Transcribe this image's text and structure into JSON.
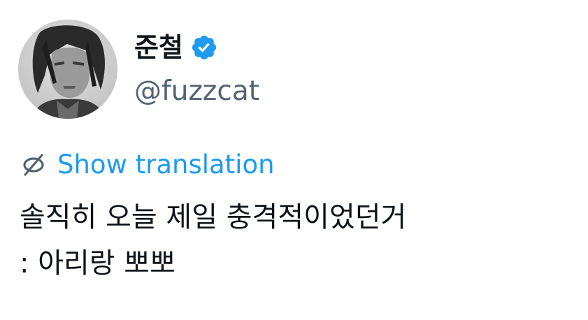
{
  "author": {
    "display_name": "준철",
    "handle": "@fuzzcat",
    "verified": true,
    "avatar_icon": "profile-photo"
  },
  "translation": {
    "icon": "globe-icon",
    "label": "Show translation"
  },
  "tweet": {
    "lines": [
      "솔직히 오늘 제일 충격적이었던거",
      ": 아리랑 뽀뽀"
    ]
  },
  "colors": {
    "link_blue": "#1d9bf0",
    "verified_blue": "#1d9bf0",
    "handle_gray": "#536471",
    "text": "#0f1419",
    "background": "#ffffff"
  }
}
